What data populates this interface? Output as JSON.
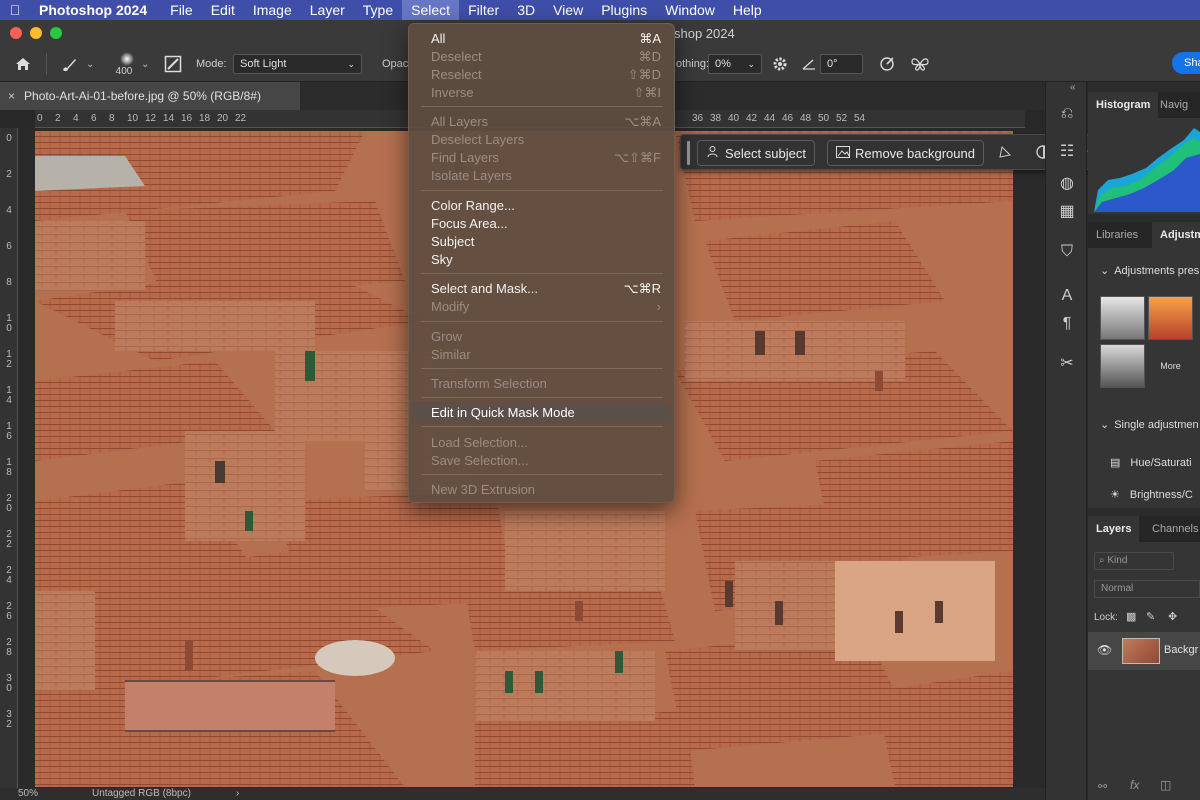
{
  "menubar": {
    "app": "Photoshop 2024",
    "items": [
      "File",
      "Edit",
      "Image",
      "Layer",
      "Type",
      "Select",
      "Filter",
      "3D",
      "View",
      "Plugins",
      "Window",
      "Help"
    ],
    "active": "Select"
  },
  "window": {
    "title": "shop 2024"
  },
  "options": {
    "brush_size": "400",
    "mode_label": "Mode:",
    "mode_value": "Soft Light",
    "opacity_label": "Opac",
    "smoothing_label": "othing:",
    "smoothing_value": "0%",
    "angle_value": "0°",
    "share_label": "Sha"
  },
  "document": {
    "tab_title": "Photo-Art-Ai-01-before.jpg @ 50% (RGB/8#)",
    "zoom": "50%",
    "color_profile": "Untagged RGB (8bpc)"
  },
  "rulers": {
    "h_left": [
      "0",
      "2",
      "4",
      "6",
      "8",
      "10",
      "12",
      "14",
      "16",
      "18",
      "20",
      "22"
    ],
    "h_right": [
      "36",
      "38",
      "40",
      "42",
      "44",
      "46",
      "48",
      "50",
      "52",
      "54"
    ],
    "v": [
      "0",
      "2",
      "4",
      "6",
      "8",
      "10",
      "12",
      "14",
      "16",
      "18",
      "20",
      "22",
      "24",
      "26",
      "28",
      "30",
      "32"
    ]
  },
  "taskbar": {
    "select_subject": "Select subject",
    "remove_background": "Remove background"
  },
  "select_menu": {
    "items": [
      {
        "label": "All",
        "shortcut": "⌘A",
        "enabled": true
      },
      {
        "label": "Deselect",
        "shortcut": "⌘D",
        "enabled": false
      },
      {
        "label": "Reselect",
        "shortcut": "⇧⌘D",
        "enabled": false
      },
      {
        "label": "Inverse",
        "shortcut": "⇧⌘I",
        "enabled": false
      },
      {
        "label": "All Layers",
        "shortcut": "⌥⌘A",
        "enabled": false
      },
      {
        "label": "Deselect Layers",
        "shortcut": "",
        "enabled": false
      },
      {
        "label": "Find Layers",
        "shortcut": "⌥⇧⌘F",
        "enabled": false
      },
      {
        "label": "Isolate Layers",
        "shortcut": "",
        "enabled": false
      },
      {
        "label": "Color Range...",
        "shortcut": "",
        "enabled": true
      },
      {
        "label": "Focus Area...",
        "shortcut": "",
        "enabled": true
      },
      {
        "label": "Subject",
        "shortcut": "",
        "enabled": true
      },
      {
        "label": "Sky",
        "shortcut": "",
        "enabled": true
      },
      {
        "label": "Select and Mask...",
        "shortcut": "⌥⌘R",
        "enabled": true
      },
      {
        "label": "Modify",
        "shortcut": "›",
        "enabled": false
      },
      {
        "label": "Grow",
        "shortcut": "",
        "enabled": false
      },
      {
        "label": "Similar",
        "shortcut": "",
        "enabled": false
      },
      {
        "label": "Transform Selection",
        "shortcut": "",
        "enabled": false
      },
      {
        "label": "Edit in Quick Mask Mode",
        "shortcut": "",
        "enabled": true
      },
      {
        "label": "Load Selection...",
        "shortcut": "",
        "enabled": false
      },
      {
        "label": "Save Selection...",
        "shortcut": "",
        "enabled": false
      },
      {
        "label": "New 3D Extrusion",
        "shortcut": "",
        "enabled": false
      }
    ],
    "highlighted": "Edit in Quick Mask Mode"
  },
  "panels": {
    "histogram_tab": "Histogram",
    "navigator_tab": "Navig",
    "libraries_tab": "Libraries",
    "adjustments_tab": "Adjustm",
    "adjustment_presets": "Adjustments pres",
    "more_label": "More",
    "single_adjustments": "Single adjustmen",
    "hue_saturation": "Hue/Saturati",
    "brightness_contrast": "Brightness/C",
    "layers_tab": "Layers",
    "channels_tab": "Channels",
    "kind_filter": "Kind",
    "blend_mode": "Normal",
    "lock_label": "Lock:",
    "background_layer": "Backgr"
  },
  "colors": {
    "menubar": "#3f4ea8",
    "menu_bg": "#5f4c40",
    "highlight": "#2c6fd6",
    "callout": "#e03a3a",
    "accent": "#1473e6"
  }
}
